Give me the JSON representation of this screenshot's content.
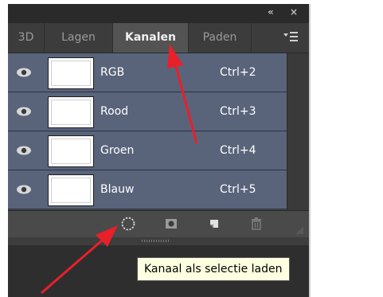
{
  "topbar": {
    "collapse_label": "«",
    "close_label": "×"
  },
  "tabs": [
    {
      "label": "3D",
      "active": false
    },
    {
      "label": "Lagen",
      "active": false
    },
    {
      "label": "Kanalen",
      "active": true
    },
    {
      "label": "Paden",
      "active": false
    }
  ],
  "channels": [
    {
      "name": "RGB",
      "shortcut": "Ctrl+2",
      "visible": true
    },
    {
      "name": "Rood",
      "shortcut": "Ctrl+3",
      "visible": true
    },
    {
      "name": "Groen",
      "shortcut": "Ctrl+4",
      "visible": true
    },
    {
      "name": "Blauw",
      "shortcut": "Ctrl+5",
      "visible": true
    }
  ],
  "bottom_buttons": [
    {
      "icon": "load-selection-icon"
    },
    {
      "icon": "save-selection-icon"
    },
    {
      "icon": "new-channel-icon"
    },
    {
      "icon": "trash-icon"
    }
  ],
  "tooltip": {
    "text": "Kanaal als selectie laden"
  },
  "colors": {
    "panel_bg": "#434343",
    "row_bg": "#59647b",
    "tab_active_bg": "#535353",
    "tooltip_bg": "#ffffe1",
    "annotation_arrow": "#e8202a"
  }
}
